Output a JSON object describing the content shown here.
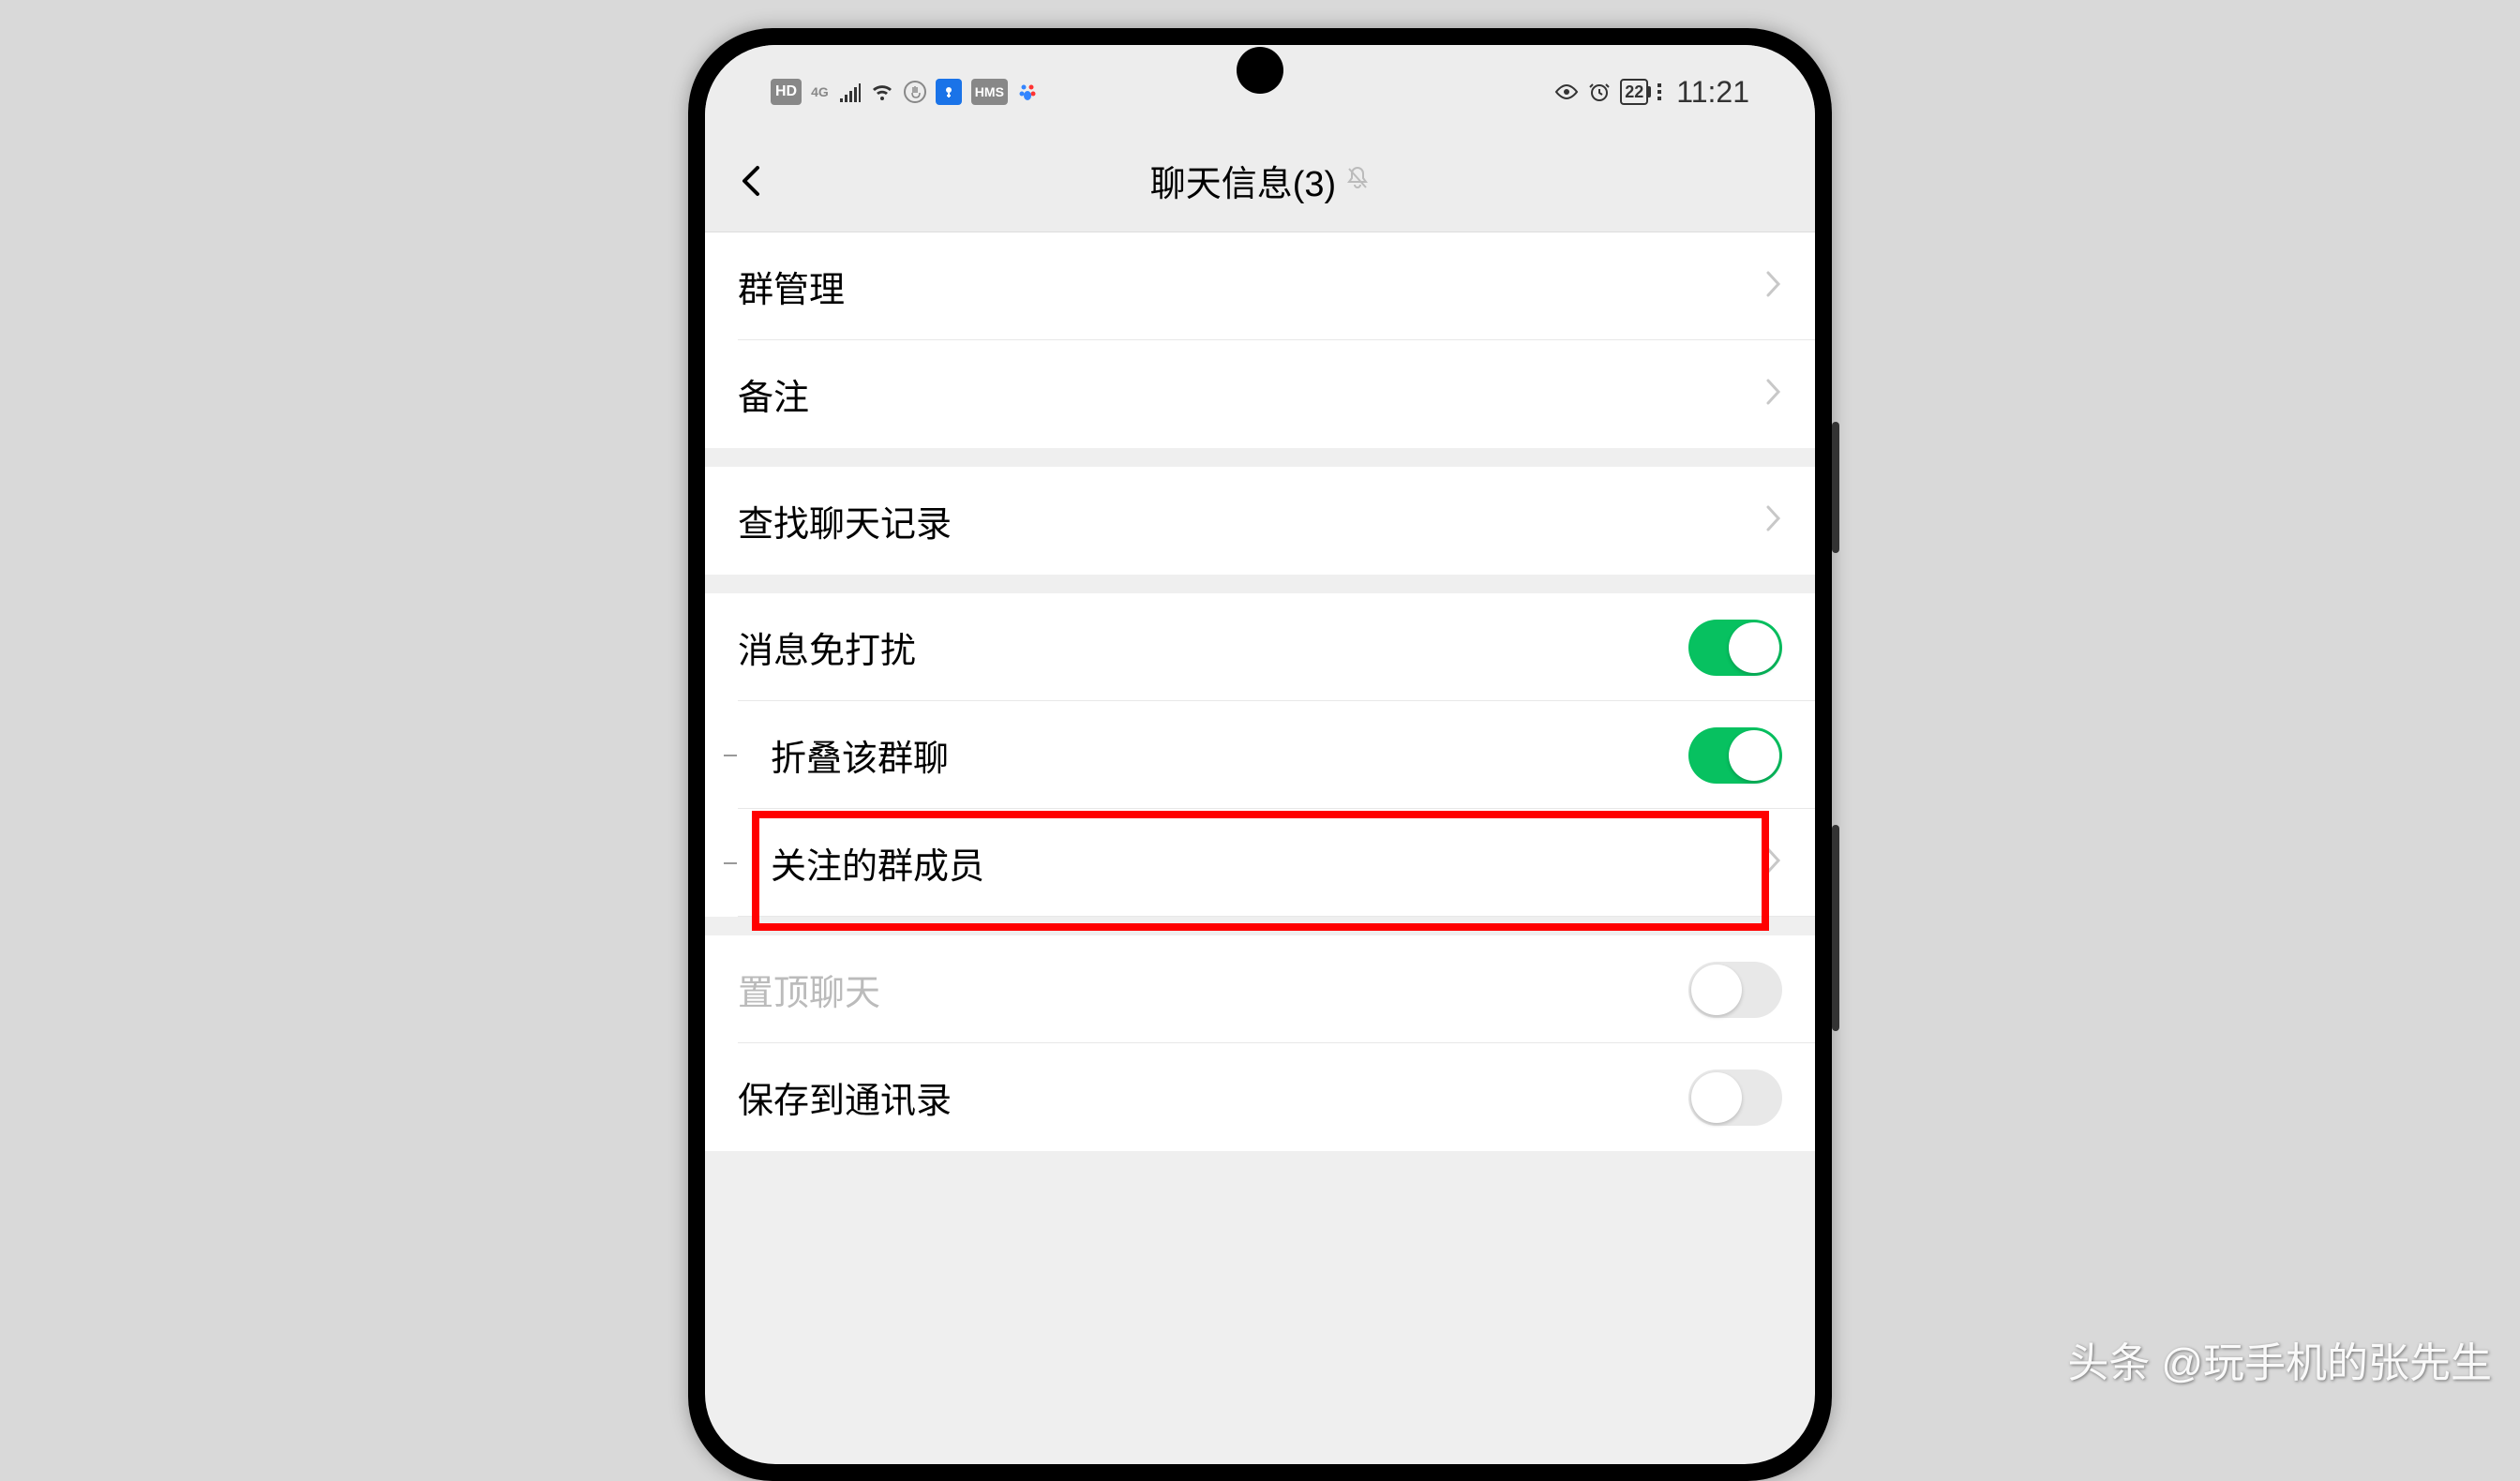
{
  "statusBar": {
    "hd": "HD",
    "signal4g": "4G",
    "hms": "HMS",
    "battery": "22",
    "time": "11:21"
  },
  "navBar": {
    "title": "聊天信息(3)"
  },
  "settings": {
    "groupManagement": "群管理",
    "remark": "备注",
    "searchChatHistory": "查找聊天记录",
    "muteNotifications": "消息免打扰",
    "foldGroupChat": "折叠该群聊",
    "followedMembers": "关注的群成员",
    "pinChat": "置顶聊天",
    "saveToContacts": "保存到通讯录"
  },
  "watermark": {
    "brand": "头条",
    "text": "@玩手机的张先生"
  }
}
